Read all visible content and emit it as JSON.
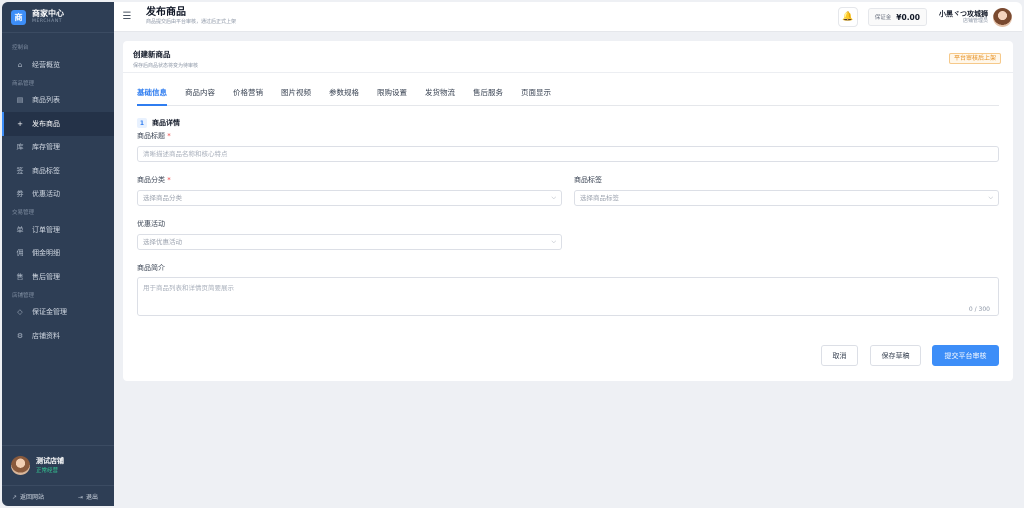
{
  "sidebar": {
    "brand_logo_char": "商",
    "brand_title": "商家中心",
    "brand_sub": "MERCHANT",
    "groups": [
      {
        "title": "控制台",
        "items": [
          {
            "icon": "⌂",
            "label": "经营概览"
          }
        ]
      },
      {
        "title": "商品管理",
        "items": [
          {
            "icon": "▤",
            "label": "商品列表"
          },
          {
            "icon": "+",
            "label": "发布商品"
          },
          {
            "icon": "库",
            "label": "库存管理"
          },
          {
            "icon": "签",
            "label": "商品标签"
          },
          {
            "icon": "券",
            "label": "优惠活动"
          }
        ]
      },
      {
        "title": "交易管理",
        "items": [
          {
            "icon": "单",
            "label": "订单管理"
          },
          {
            "icon": "佣",
            "label": "佣金明细"
          },
          {
            "icon": "售",
            "label": "售后管理"
          }
        ]
      },
      {
        "title": "店铺管理",
        "items": [
          {
            "icon": "◇",
            "label": "保证金管理"
          },
          {
            "icon": "⚙",
            "label": "店铺资料"
          }
        ]
      }
    ],
    "active_item": "发布商品",
    "store": {
      "name": "测试店铺",
      "status": "正常经营"
    },
    "footer": {
      "back_icon": "↗",
      "back_label": "返回网站",
      "logout_icon": "⇥",
      "logout_label": "退出"
    }
  },
  "header": {
    "menu_icon": "☰",
    "title": "发布商品",
    "subtitle": "商品提交后由平台审核，通过后正式上架",
    "bell_icon": "🔔",
    "deposit_label": "保证金",
    "deposit_value": "¥0.00",
    "user_name": "小黑ヾつ攻城狮",
    "user_role": "店铺管理员"
  },
  "card": {
    "title": "创建新商品",
    "subtitle": "保存后商品状态将变为待审核",
    "review_tag": "平台审核后上架",
    "tabs": [
      "基础信息",
      "商品内容",
      "价格营销",
      "图片视频",
      "参数规格",
      "限购设置",
      "发货物流",
      "售后服务",
      "页面显示"
    ],
    "active_tab": "基础信息",
    "section_no": "1",
    "section_title": "商品详情",
    "fields": {
      "title_label": "商品标题",
      "title_placeholder": "清晰描述商品名称和核心特点",
      "category_label": "商品分类",
      "category_placeholder": "选择商品分类",
      "tag_label": "商品标签",
      "tag_placeholder": "选择商品标签",
      "promo_label": "优惠活动",
      "promo_placeholder": "选择优惠活动",
      "intro_label": "商品简介",
      "intro_placeholder": "用于商品列表和详情页简要展示",
      "intro_counter": "0 / 300",
      "required_mark": "*"
    },
    "buttons": {
      "cancel": "取消",
      "draft": "保存草稿",
      "submit": "提交平台审核"
    }
  }
}
